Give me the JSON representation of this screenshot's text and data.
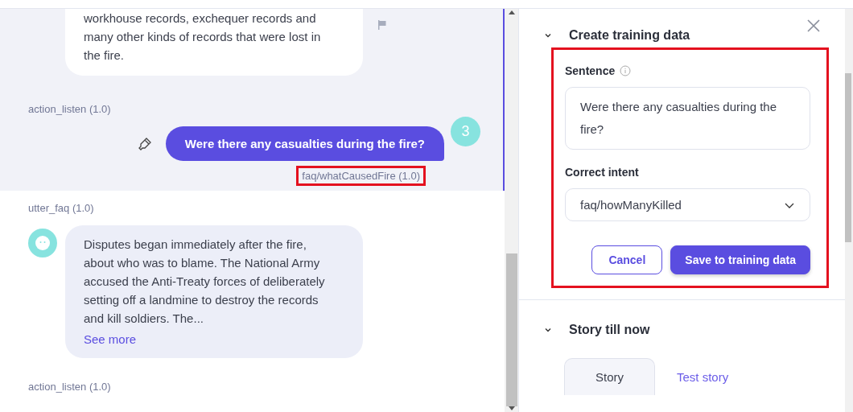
{
  "conversation": {
    "messages": [
      {
        "kind": "bot",
        "text": "workhouse records, exchequer records and many other kinds of records that were lost in the fire.",
        "flagged": true,
        "active": true
      },
      {
        "kind": "action",
        "text": "action_listen (1.0)",
        "active": true
      },
      {
        "kind": "user",
        "text": "Were there any casualties during the fire?",
        "turn": "3",
        "intent": "faq/whatCausedFire (1.0)",
        "highlighted": true,
        "active": true
      },
      {
        "kind": "action",
        "text": "utter_faq (1.0)",
        "active": false
      },
      {
        "kind": "bot",
        "text": "Disputes began immediately after the fire, about who was to blame. The National Army accused the Anti-Treaty forces of deliberately setting off a landmine to destroy the records and kill soldiers. The...",
        "link": "See more",
        "avatar": true,
        "active": false
      },
      {
        "kind": "action",
        "text": "action_listen (1.0)",
        "active": false
      }
    ]
  },
  "training_panel": {
    "title": "Create training data",
    "expanded": true,
    "highlighted": true,
    "sentence_label": "Sentence",
    "sentence_value": "Were there any casualties during the fire?",
    "intent_label": "Correct intent",
    "intent_value": "faq/howManyKilled",
    "buttons": [
      {
        "label": "Cancel",
        "kind": "secondary"
      },
      {
        "label": "Save to training data",
        "kind": "primary"
      }
    ]
  },
  "story_panel": {
    "title": "Story till now",
    "expanded": true,
    "tabs": [
      {
        "label": "Story",
        "selected": true
      },
      {
        "label": "Test story",
        "selected": false
      }
    ]
  }
}
